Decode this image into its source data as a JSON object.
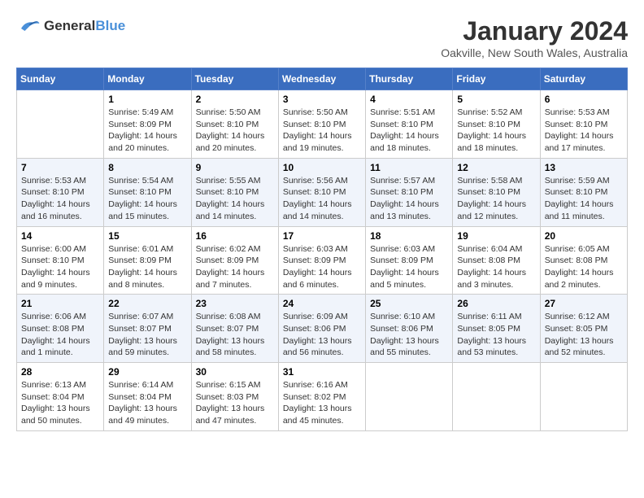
{
  "header": {
    "logo_general": "General",
    "logo_blue": "Blue",
    "month_year": "January 2024",
    "location": "Oakville, New South Wales, Australia"
  },
  "days_of_week": [
    "Sunday",
    "Monday",
    "Tuesday",
    "Wednesday",
    "Thursday",
    "Friday",
    "Saturday"
  ],
  "weeks": [
    [
      {
        "day": "",
        "info": ""
      },
      {
        "day": "1",
        "info": "Sunrise: 5:49 AM\nSunset: 8:09 PM\nDaylight: 14 hours\nand 20 minutes."
      },
      {
        "day": "2",
        "info": "Sunrise: 5:50 AM\nSunset: 8:10 PM\nDaylight: 14 hours\nand 20 minutes."
      },
      {
        "day": "3",
        "info": "Sunrise: 5:50 AM\nSunset: 8:10 PM\nDaylight: 14 hours\nand 19 minutes."
      },
      {
        "day": "4",
        "info": "Sunrise: 5:51 AM\nSunset: 8:10 PM\nDaylight: 14 hours\nand 18 minutes."
      },
      {
        "day": "5",
        "info": "Sunrise: 5:52 AM\nSunset: 8:10 PM\nDaylight: 14 hours\nand 18 minutes."
      },
      {
        "day": "6",
        "info": "Sunrise: 5:53 AM\nSunset: 8:10 PM\nDaylight: 14 hours\nand 17 minutes."
      }
    ],
    [
      {
        "day": "7",
        "info": "Sunrise: 5:53 AM\nSunset: 8:10 PM\nDaylight: 14 hours\nand 16 minutes."
      },
      {
        "day": "8",
        "info": "Sunrise: 5:54 AM\nSunset: 8:10 PM\nDaylight: 14 hours\nand 15 minutes."
      },
      {
        "day": "9",
        "info": "Sunrise: 5:55 AM\nSunset: 8:10 PM\nDaylight: 14 hours\nand 14 minutes."
      },
      {
        "day": "10",
        "info": "Sunrise: 5:56 AM\nSunset: 8:10 PM\nDaylight: 14 hours\nand 14 minutes."
      },
      {
        "day": "11",
        "info": "Sunrise: 5:57 AM\nSunset: 8:10 PM\nDaylight: 14 hours\nand 13 minutes."
      },
      {
        "day": "12",
        "info": "Sunrise: 5:58 AM\nSunset: 8:10 PM\nDaylight: 14 hours\nand 12 minutes."
      },
      {
        "day": "13",
        "info": "Sunrise: 5:59 AM\nSunset: 8:10 PM\nDaylight: 14 hours\nand 11 minutes."
      }
    ],
    [
      {
        "day": "14",
        "info": "Sunrise: 6:00 AM\nSunset: 8:10 PM\nDaylight: 14 hours\nand 9 minutes."
      },
      {
        "day": "15",
        "info": "Sunrise: 6:01 AM\nSunset: 8:09 PM\nDaylight: 14 hours\nand 8 minutes."
      },
      {
        "day": "16",
        "info": "Sunrise: 6:02 AM\nSunset: 8:09 PM\nDaylight: 14 hours\nand 7 minutes."
      },
      {
        "day": "17",
        "info": "Sunrise: 6:03 AM\nSunset: 8:09 PM\nDaylight: 14 hours\nand 6 minutes."
      },
      {
        "day": "18",
        "info": "Sunrise: 6:03 AM\nSunset: 8:09 PM\nDaylight: 14 hours\nand 5 minutes."
      },
      {
        "day": "19",
        "info": "Sunrise: 6:04 AM\nSunset: 8:08 PM\nDaylight: 14 hours\nand 3 minutes."
      },
      {
        "day": "20",
        "info": "Sunrise: 6:05 AM\nSunset: 8:08 PM\nDaylight: 14 hours\nand 2 minutes."
      }
    ],
    [
      {
        "day": "21",
        "info": "Sunrise: 6:06 AM\nSunset: 8:08 PM\nDaylight: 14 hours\nand 1 minute."
      },
      {
        "day": "22",
        "info": "Sunrise: 6:07 AM\nSunset: 8:07 PM\nDaylight: 13 hours\nand 59 minutes."
      },
      {
        "day": "23",
        "info": "Sunrise: 6:08 AM\nSunset: 8:07 PM\nDaylight: 13 hours\nand 58 minutes."
      },
      {
        "day": "24",
        "info": "Sunrise: 6:09 AM\nSunset: 8:06 PM\nDaylight: 13 hours\nand 56 minutes."
      },
      {
        "day": "25",
        "info": "Sunrise: 6:10 AM\nSunset: 8:06 PM\nDaylight: 13 hours\nand 55 minutes."
      },
      {
        "day": "26",
        "info": "Sunrise: 6:11 AM\nSunset: 8:05 PM\nDaylight: 13 hours\nand 53 minutes."
      },
      {
        "day": "27",
        "info": "Sunrise: 6:12 AM\nSunset: 8:05 PM\nDaylight: 13 hours\nand 52 minutes."
      }
    ],
    [
      {
        "day": "28",
        "info": "Sunrise: 6:13 AM\nSunset: 8:04 PM\nDaylight: 13 hours\nand 50 minutes."
      },
      {
        "day": "29",
        "info": "Sunrise: 6:14 AM\nSunset: 8:04 PM\nDaylight: 13 hours\nand 49 minutes."
      },
      {
        "day": "30",
        "info": "Sunrise: 6:15 AM\nSunset: 8:03 PM\nDaylight: 13 hours\nand 47 minutes."
      },
      {
        "day": "31",
        "info": "Sunrise: 6:16 AM\nSunset: 8:02 PM\nDaylight: 13 hours\nand 45 minutes."
      },
      {
        "day": "",
        "info": ""
      },
      {
        "day": "",
        "info": ""
      },
      {
        "day": "",
        "info": ""
      }
    ]
  ]
}
